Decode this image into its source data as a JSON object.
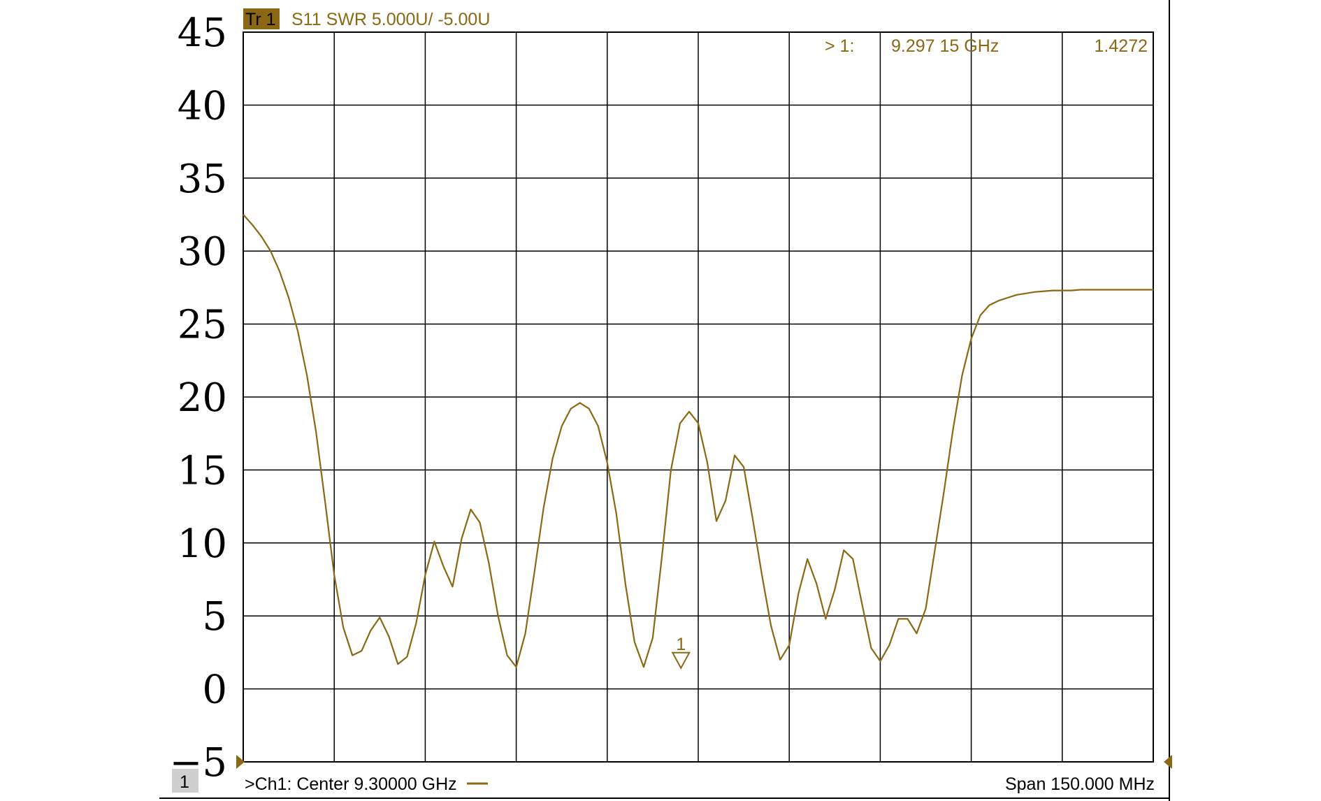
{
  "header": {
    "trace_label": "Tr 1",
    "trace_settings": "S11 SWR 5.000U/  -5.00U"
  },
  "marker_readout": {
    "marker": "> 1:",
    "frequency": "9.297 15  GHz",
    "value": "1.4272"
  },
  "footer": {
    "channel_index": "1",
    "center": ">Ch1:  Center   9.30000 GHz",
    "span": "Span  150.000 MHz"
  },
  "colors": {
    "trace": "#8B6914",
    "badge_bg": "#8B6914",
    "readout_text": "#8B6914",
    "grid": "#000000"
  },
  "chart_data": {
    "type": "line",
    "title": "",
    "xlabel": "",
    "ylabel": "",
    "xlim": [
      9.225,
      9.375
    ],
    "ylim": [
      -5,
      45
    ],
    "x_unit": "GHz",
    "y_ticks": [
      "45",
      "40",
      "35",
      "30",
      "25",
      "20",
      "15",
      "10",
      "5",
      "0",
      "−5"
    ],
    "grid": true,
    "marker": {
      "label": "1",
      "x": 9.29715,
      "y": 1.4272
    },
    "series": [
      {
        "x": [
          9.225,
          9.2265,
          9.228,
          9.2295,
          9.231,
          9.2325,
          9.234,
          9.2355,
          9.237,
          9.2385,
          9.24,
          9.2415,
          9.243,
          9.2445,
          9.246,
          9.2475,
          9.249,
          9.2505,
          9.252,
          9.2535,
          9.255,
          9.2565,
          9.258,
          9.2595,
          9.261,
          9.2625,
          9.264,
          9.2655,
          9.267,
          9.2685,
          9.27,
          9.2715,
          9.273,
          9.2745,
          9.276,
          9.2775,
          9.279,
          9.2805,
          9.282,
          9.2835,
          9.285,
          9.2865,
          9.288,
          9.2895,
          9.291,
          9.2925,
          9.294,
          9.2955,
          9.297,
          9.2985,
          9.3,
          9.3015,
          9.303,
          9.3045,
          9.306,
          9.3075,
          9.309,
          9.3105,
          9.312,
          9.3135,
          9.315,
          9.3165,
          9.318,
          9.3195,
          9.321,
          9.3225,
          9.324,
          9.3255,
          9.327,
          9.3285,
          9.33,
          9.3315,
          9.333,
          9.3345,
          9.336,
          9.3375,
          9.339,
          9.3405,
          9.342,
          9.3435,
          9.345,
          9.3465,
          9.348,
          9.3495,
          9.351,
          9.3525,
          9.354,
          9.3555,
          9.357,
          9.3585,
          9.36,
          9.3615,
          9.363,
          9.3645,
          9.366,
          9.3675,
          9.369,
          9.3705,
          9.372,
          9.3735,
          9.375
        ],
        "y": [
          32.5,
          31.8,
          31.0,
          30.0,
          28.6,
          26.8,
          24.5,
          21.5,
          17.6,
          12.8,
          7.8,
          4.2,
          2.3,
          2.6,
          4.0,
          4.9,
          3.6,
          1.7,
          2.2,
          4.5,
          7.8,
          10.1,
          8.4,
          7.0,
          10.3,
          12.3,
          11.4,
          8.6,
          5.0,
          2.3,
          1.5,
          3.8,
          8.0,
          12.4,
          15.8,
          18.0,
          19.2,
          19.6,
          19.2,
          18.0,
          15.5,
          12.0,
          7.2,
          3.2,
          1.5,
          3.5,
          9.0,
          15.0,
          18.2,
          19.0,
          18.2,
          15.5,
          11.5,
          12.9,
          16.0,
          15.2,
          11.6,
          7.8,
          4.3,
          2.0,
          3.0,
          6.5,
          8.9,
          7.2,
          4.8,
          6.8,
          9.5,
          8.9,
          5.8,
          2.8,
          1.9,
          3.0,
          4.8,
          4.8,
          3.8,
          5.5,
          9.5,
          13.5,
          17.8,
          21.5,
          24.0,
          25.6,
          26.3,
          26.6,
          26.8,
          27.0,
          27.1,
          27.2,
          27.25,
          27.3,
          27.3,
          27.3,
          27.35,
          27.35,
          27.35,
          27.35,
          27.35,
          27.35,
          27.35,
          27.35,
          27.35
        ]
      }
    ]
  }
}
